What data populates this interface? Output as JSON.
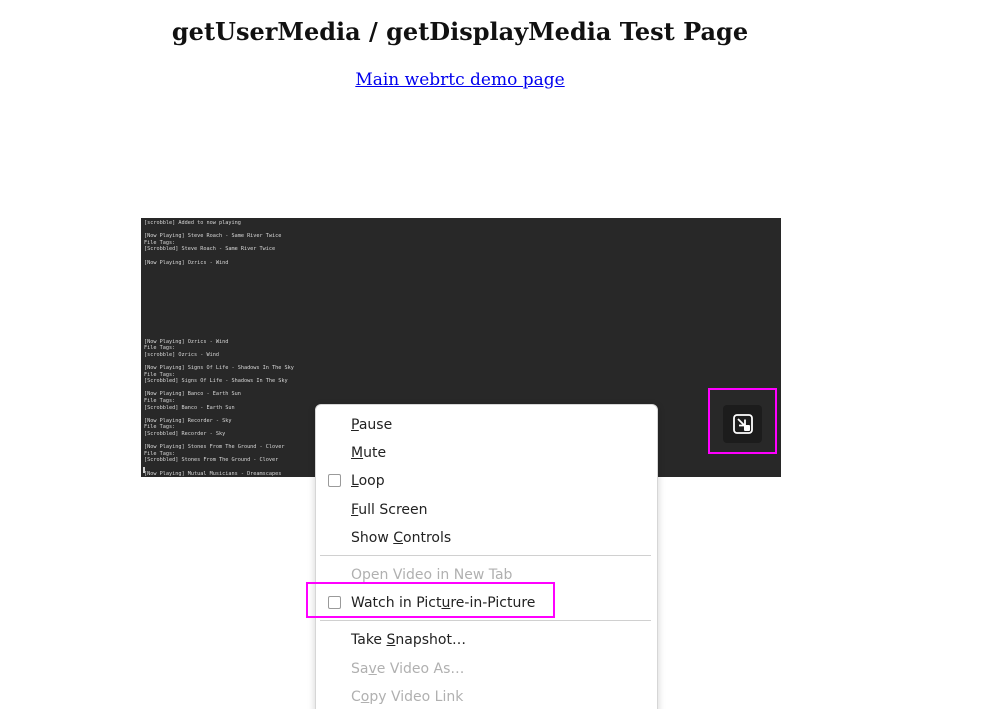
{
  "page": {
    "title": "getUserMedia / getDisplayMedia Test Page",
    "main_link": "Main webrtc demo page"
  },
  "video": {
    "terminal_lines": [
      "[scrobble] Added to now playing",
      "",
      "[Now Playing] Steve Roach - Same River Twice",
      "File Tags:",
      "[Scrobbled] Steve Roach - Same River Twice",
      "",
      "[Now Playing] Ozrics - Wind",
      "",
      "",
      "",
      "",
      "",
      "",
      "",
      "",
      "",
      "",
      "",
      "[Now Playing] Ozrics - Wind",
      "File Tags:",
      "[scrobble] Ozrics - Wind",
      "",
      "[Now Playing] Signs Of Life - Shadows In The Sky",
      "File Tags:",
      "[Scrobbled] Signs Of Life - Shadows In The Sky",
      "",
      "[Now Playing] Banco - Earth Sun",
      "File Tags:",
      "[Scrobbled] Banco - Earth Sun",
      "",
      "[Now Playing] Recorder - Sky",
      "File Tags:",
      "[Scrobbled] Recorder - Sky",
      "",
      "[Now Playing] Stones From The Ground - Clover",
      "File Tags:",
      "[Scrobbled] Stones From The Ground - Clover",
      "",
      "[Now Playing] Mutual Musicians - Dreamscapes"
    ]
  },
  "pip_toggle": {
    "icon": "picture-in-picture-icon"
  },
  "context_menu": {
    "items": [
      {
        "label": "Pause",
        "accel": "P",
        "disabled": false,
        "checkbox": false
      },
      {
        "label": "Mute",
        "accel": "M",
        "disabled": false,
        "checkbox": false
      },
      {
        "label": "Loop",
        "accel": "L",
        "disabled": false,
        "checkbox": true
      },
      {
        "label": "Full Screen",
        "accel": "F",
        "disabled": false,
        "checkbox": false
      },
      {
        "label": "Show Controls",
        "accel": "C",
        "disabled": false,
        "checkbox": false
      },
      {
        "label": "Open Video in New Tab",
        "accel": "",
        "disabled": true,
        "checkbox": false
      },
      {
        "label": "Watch in Picture-in-Picture",
        "accel": "u",
        "disabled": false,
        "checkbox": true
      },
      {
        "label": "Take Snapshot…",
        "accel": "S",
        "disabled": false,
        "checkbox": false
      },
      {
        "label": "Save Video As…",
        "accel": "v",
        "disabled": true,
        "checkbox": false
      },
      {
        "label": "Copy Video Link",
        "accel": "o",
        "disabled": true,
        "checkbox": false
      }
    ]
  },
  "colors": {
    "highlight": "#ff00ff",
    "link": "#0000ee",
    "video_background": "#282828"
  }
}
